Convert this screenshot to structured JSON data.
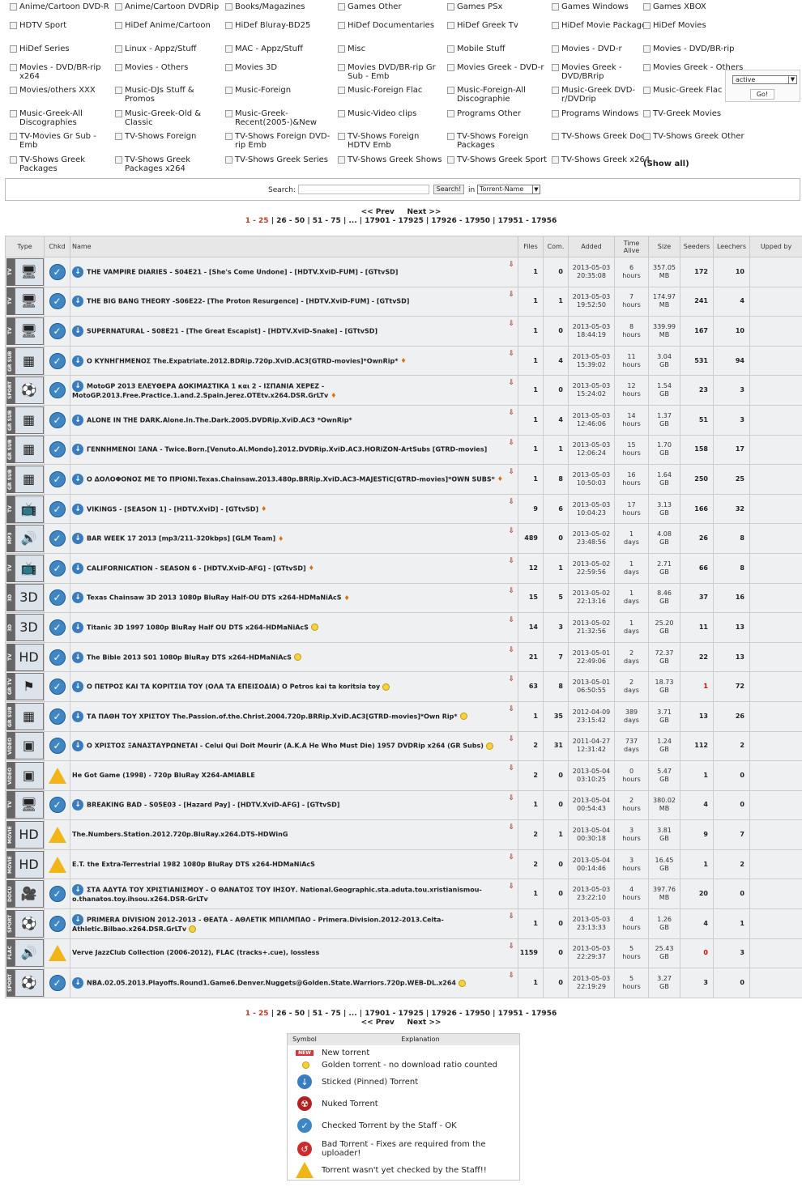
{
  "categories": [
    {
      "label": "Anime/Cartoon DVD-R",
      "col": 0,
      "row": 0
    },
    {
      "label": "Anime/Cartoon DVDRip",
      "col": 1,
      "row": 0
    },
    {
      "label": "Books/Magazines",
      "col": 2,
      "row": 0
    },
    {
      "label": "Games Other",
      "col": 3,
      "row": 0
    },
    {
      "label": "Games PSx",
      "col": 4,
      "row": 0
    },
    {
      "label": "Games Windows",
      "col": 5,
      "row": 0
    },
    {
      "label": "Games XBOX",
      "col": 6,
      "row": 0
    },
    {
      "label": "HDTV Sport",
      "col": 0,
      "row": 1
    },
    {
      "label": "HiDef Anime/Cartoon",
      "col": 1,
      "row": 1
    },
    {
      "label": "HiDef Bluray-BD25",
      "col": 2,
      "row": 1
    },
    {
      "label": "HiDef Documentaries",
      "col": 3,
      "row": 1
    },
    {
      "label": "HiDef Greek Tv",
      "col": 4,
      "row": 1
    },
    {
      "label": "HiDef Movie Packages",
      "col": 5,
      "row": 1
    },
    {
      "label": "HiDef Movies",
      "col": 6,
      "row": 1
    },
    {
      "label": "HiDef Series",
      "col": 0,
      "row": 2
    },
    {
      "label": "Linux - Appz/Stuff",
      "col": 1,
      "row": 2
    },
    {
      "label": "MAC - Appz/Stuff",
      "col": 2,
      "row": 2
    },
    {
      "label": "Misc",
      "col": 3,
      "row": 2
    },
    {
      "label": "Mobile Stuff",
      "col": 4,
      "row": 2
    },
    {
      "label": "Movies - DVD-r",
      "col": 5,
      "row": 2
    },
    {
      "label": "Movies - DVD/BR-rip",
      "col": 6,
      "row": 2
    },
    {
      "label": "Movies - DVD/BR-rip x264",
      "col": 0,
      "row": 3
    },
    {
      "label": "Movies - Others",
      "col": 1,
      "row": 3
    },
    {
      "label": "Movies 3D",
      "col": 2,
      "row": 3
    },
    {
      "label": "Movies DVD/BR-rip Gr Sub - Emb",
      "col": 3,
      "row": 3
    },
    {
      "label": "Movies Greek - DVD-r",
      "col": 4,
      "row": 3
    },
    {
      "label": "Movies Greek - DVD/BRrip",
      "col": 5,
      "row": 3
    },
    {
      "label": "Movies Greek - Others",
      "col": 6,
      "row": 3
    },
    {
      "label": "Movies/others XXX",
      "col": 0,
      "row": 4
    },
    {
      "label": "Music-DJs Stuff & Promos",
      "col": 1,
      "row": 4
    },
    {
      "label": "Music-Foreign",
      "col": 2,
      "row": 4
    },
    {
      "label": "Music-Foreign Flac",
      "col": 3,
      "row": 4
    },
    {
      "label": "Music-Foreign-All Discographie",
      "col": 4,
      "row": 4
    },
    {
      "label": "Music-Greek DVD-r/DVDrip",
      "col": 5,
      "row": 4
    },
    {
      "label": "Music-Greek Flac",
      "col": 6,
      "row": 4
    },
    {
      "label": "Music-Greek-All Discographies",
      "col": 0,
      "row": 5
    },
    {
      "label": "Music-Greek-Old & Classic",
      "col": 1,
      "row": 5
    },
    {
      "label": "Music-Greek-Recent(2005-)&New",
      "col": 2,
      "row": 5
    },
    {
      "label": "Music-Video clips",
      "col": 3,
      "row": 5
    },
    {
      "label": "Programs Other",
      "col": 4,
      "row": 5
    },
    {
      "label": "Programs Windows",
      "col": 5,
      "row": 5
    },
    {
      "label": "TV-Greek Movies",
      "col": 6,
      "row": 5
    },
    {
      "label": "TV-Movies Gr Sub - Emb",
      "col": 0,
      "row": 6
    },
    {
      "label": "TV-Shows Foreign",
      "col": 1,
      "row": 6
    },
    {
      "label": "TV-Shows Foreign DVD-rip Emb",
      "col": 2,
      "row": 6
    },
    {
      "label": "TV-Shows Foreign HDTV Emb",
      "col": 3,
      "row": 6
    },
    {
      "label": "TV-Shows Foreign Packages",
      "col": 4,
      "row": 6
    },
    {
      "label": "TV-Shows Greek Doc",
      "col": 5,
      "row": 6
    },
    {
      "label": "TV-Shows Greek Other",
      "col": 6,
      "row": 6
    },
    {
      "label": "TV-Shows Greek Packages",
      "col": 0,
      "row": 7
    },
    {
      "label": "TV-Shows Greek Packages x264",
      "col": 1,
      "row": 7
    },
    {
      "label": "TV-Shows Greek Series",
      "col": 2,
      "row": 7
    },
    {
      "label": "TV-Shows Greek Shows",
      "col": 3,
      "row": 7
    },
    {
      "label": "TV-Shows Greek Sport",
      "col": 4,
      "row": 7
    },
    {
      "label": "TV-Shows Greek x264",
      "col": 5,
      "row": 7
    }
  ],
  "show_all": "(Show all)",
  "filter": {
    "value": "active",
    "go": "Go!"
  },
  "search": {
    "label": "Search:",
    "button": "Search!",
    "in": "in",
    "field": "Torrent-Name"
  },
  "pager": {
    "prev": "<< Prev",
    "next": "Next >>",
    "current": "1 - 25",
    "pages": [
      "26 - 50",
      "51 - 75",
      "...",
      "17901 - 17925",
      "17926 - 17950",
      "17951 - 17956"
    ]
  },
  "table": {
    "headers": {
      "type": "Type",
      "checked": "Chkd",
      "name": "Name",
      "files": "Files",
      "comments": "Com.",
      "added": "Added",
      "alive": "Time Alive",
      "size": "Size",
      "seeders": "Seeders",
      "leechers": "Leechers",
      "uploader": "Upped by"
    },
    "rows": [
      {
        "type": "TV",
        "icon": "tv",
        "badge": "embedded",
        "check": "ok",
        "name": "THE VAMPIRE DIARIES - S04E21 - [She's Come Undone] - [HDTV.XviD-FUM] - [GTtvSD]",
        "marker": "",
        "files": "1",
        "comments": "0",
        "date": "2013-05-03",
        "time": "20:35:08",
        "alive_n": "6",
        "alive_u": "hours",
        "size_n": "357.05",
        "size_u": "MB",
        "seeders": "172",
        "leechers": "10",
        "seed_red": false
      },
      {
        "type": "TV",
        "icon": "tv",
        "badge": "embedded",
        "check": "ok",
        "name": "THE BIG BANG THEORY -S06E22- [The Proton Resurgence] - [HDTV.XviD-FUM] - [GTtvSD]",
        "marker": "",
        "files": "1",
        "comments": "1",
        "date": "2013-05-03",
        "time": "19:52:50",
        "alive_n": "7",
        "alive_u": "hours",
        "size_n": "174.97",
        "size_u": "MB",
        "seeders": "241",
        "leechers": "4",
        "seed_red": false
      },
      {
        "type": "TV",
        "icon": "tv",
        "badge": "embedded",
        "check": "ok",
        "name": "SUPERNATURAL - S08E21 - [The Great Escapist] - [HDTV.XviD-Snake] - [GTtvSD]",
        "marker": "",
        "files": "1",
        "comments": "0",
        "date": "2013-05-03",
        "time": "18:44:19",
        "alive_n": "8",
        "alive_u": "hours",
        "size_n": "339.99",
        "size_u": "MB",
        "seeders": "167",
        "leechers": "10",
        "seed_red": false
      },
      {
        "type": "GR SUB",
        "icon": "xvid",
        "badge": "embedded",
        "check": "ok",
        "name": "Ο ΚΥΝΗΓΗΜΕΝΟΣ The.Expatriate.2012.BDRip.720p.XviD.AC3[GTRD-movies]*OwnRip*",
        "marker": "flame",
        "files": "1",
        "comments": "4",
        "date": "2013-05-03",
        "time": "15:39:02",
        "alive_n": "11",
        "alive_u": "hours",
        "size_n": "3.04",
        "size_u": "GB",
        "seeders": "531",
        "leechers": "94",
        "seed_red": false
      },
      {
        "type": "SPORT",
        "icon": "ball",
        "badge": "",
        "check": "ok",
        "name": "MotoGP 2013 ΕΛΕΥΘΕΡΑ ΔΟΚΙΜΑΣΤΙΚΑ 1 και 2 - ΙΣΠΑΝΙΑ ΧΕΡΕΖ - MotoGP.2013.Free.Practice.1.and.2.Spain.Jerez.OTEtv.x264.DSR.GrLTv",
        "marker": "flame",
        "files": "1",
        "comments": "0",
        "date": "2013-05-03",
        "time": "15:24:02",
        "alive_n": "12",
        "alive_u": "hours",
        "size_n": "1.54",
        "size_u": "GB",
        "seeders": "23",
        "leechers": "3",
        "seed_red": false
      },
      {
        "type": "GR SUB",
        "icon": "xvid",
        "badge": "embedded",
        "check": "ok",
        "name": "ALONE IN THE DARK.Alone.In.The.Dark.2005.DVDRip.XviD.AC3 *OwnRip*",
        "marker": "",
        "files": "1",
        "comments": "4",
        "date": "2013-05-03",
        "time": "12:46:06",
        "alive_n": "14",
        "alive_u": "hours",
        "size_n": "1.37",
        "size_u": "GB",
        "seeders": "51",
        "leechers": "3",
        "seed_red": false
      },
      {
        "type": "GR SUB",
        "icon": "xvid",
        "badge": "embedded",
        "check": "ok",
        "name": "ΓΕΝΝΗΜΕΝΟΙ ΞΑΝΑ - Twice.Born.[Venuto.Al.Mondo].2012.DVDRip.XviD.AC3.HORiZON-ArtSubs [GTRD-movies]",
        "marker": "",
        "files": "1",
        "comments": "1",
        "date": "2013-05-03",
        "time": "12:06:24",
        "alive_n": "15",
        "alive_u": "hours",
        "size_n": "1.70",
        "size_u": "GB",
        "seeders": "158",
        "leechers": "17",
        "seed_red": false
      },
      {
        "type": "GR SUB",
        "icon": "xvid",
        "badge": "embedded",
        "check": "ok",
        "name": "Ο ΔΟΛΟΦΟΝΟΣ ΜΕ ΤΟ ΠΡΙΟΝΙ.Texas.Chainsaw.2013.480p.BRRip.XviD.AC3-MAJESTiC[GTRD-movies]*OWN SUBS*",
        "marker": "flame",
        "files": "1",
        "comments": "8",
        "date": "2013-05-03",
        "time": "10:50:03",
        "alive_n": "16",
        "alive_u": "hours",
        "size_n": "1.64",
        "size_u": "GB",
        "seeders": "250",
        "leechers": "25",
        "seed_red": false
      },
      {
        "type": "TV",
        "icon": "tvpack",
        "badge": "",
        "check": "ok",
        "name": "VIKINGS - [SEASON 1] - [HDTV.XviD] - [GTtvSD]",
        "marker": "flame",
        "files": "9",
        "comments": "6",
        "date": "2013-05-03",
        "time": "10:04:23",
        "alive_n": "17",
        "alive_u": "hours",
        "size_n": "3.13",
        "size_u": "GB",
        "seeders": "166",
        "leechers": "32",
        "seed_red": false
      },
      {
        "type": "MP3",
        "icon": "speaker",
        "badge": "",
        "check": "ok",
        "name": "BAR WEEK 17 2013 [mp3/211-320kbps] [GLM Team]",
        "marker": "flame",
        "files": "489",
        "comments": "0",
        "date": "2013-05-02",
        "time": "23:48:56",
        "alive_n": "1",
        "alive_u": "days",
        "size_n": "4.08",
        "size_u": "GB",
        "seeders": "26",
        "leechers": "8",
        "seed_red": false
      },
      {
        "type": "TV",
        "icon": "tvpack",
        "badge": "",
        "check": "ok",
        "name": "CALIFORNICATION - SEASON 6 - [HDTV.XviD-AFG] - [GTtvSD]",
        "marker": "flame",
        "files": "12",
        "comments": "1",
        "date": "2013-05-02",
        "time": "22:59:56",
        "alive_n": "1",
        "alive_u": "days",
        "size_n": "2.71",
        "size_u": "GB",
        "seeders": "66",
        "leechers": "8",
        "seed_red": false
      },
      {
        "type": "3D",
        "icon": "3d",
        "badge": "",
        "check": "ok",
        "name": "Texas Chainsaw 3D 2013 1080p BluRay Half-OU DTS x264-HDMaNiAcS",
        "marker": "flame",
        "files": "15",
        "comments": "5",
        "date": "2013-05-02",
        "time": "22:13:16",
        "alive_n": "1",
        "alive_u": "days",
        "size_n": "8.46",
        "size_u": "GB",
        "seeders": "37",
        "leechers": "16",
        "seed_red": false
      },
      {
        "type": "3D",
        "icon": "3d",
        "badge": "",
        "check": "ok",
        "name": "Titanic 3D 1997 1080p BluRay Half OU DTS x264-HDMaNiAcS",
        "marker": "gold",
        "files": "14",
        "comments": "3",
        "date": "2013-05-02",
        "time": "21:32:56",
        "alive_n": "1",
        "alive_u": "days",
        "size_n": "25.20",
        "size_u": "GB",
        "seeders": "11",
        "leechers": "13",
        "seed_red": false
      },
      {
        "type": "TV",
        "icon": "hd",
        "badge": "",
        "check": "ok",
        "name": "The Bible 2013 S01 1080p BluRay DTS x264-HDMaNiAcS",
        "marker": "gold",
        "files": "21",
        "comments": "7",
        "date": "2013-05-01",
        "time": "22:49:06",
        "alive_n": "2",
        "alive_u": "days",
        "size_n": "72.37",
        "size_u": "GB",
        "seeders": "22",
        "leechers": "13",
        "seed_red": false
      },
      {
        "type": "GR TV",
        "icon": "greek",
        "badge": "",
        "check": "ok",
        "name": "Ο ΠΕΤΡΟΣ ΚΑΙ ΤΑ ΚΟΡΙΤΣΙΑ ΤΟΥ (ΟΛΑ ΤΑ ΕΠΕΙΣΟΔΙΑ) O Petros kai ta koritsia toy",
        "marker": "gold",
        "files": "63",
        "comments": "8",
        "date": "2013-05-01",
        "time": "06:50:55",
        "alive_n": "2",
        "alive_u": "days",
        "size_n": "18.73",
        "size_u": "GB",
        "seeders": "1",
        "leechers": "72",
        "seed_red": true
      },
      {
        "type": "GR SUB",
        "icon": "xvid",
        "badge": "embedded",
        "check": "ok",
        "name": "ΤΑ ΠΑΘΗ ΤΟΥ ΧΡΙΣΤΟΥ The.Passion.of.the.Christ.2004.720p.BRRip.XviD.AC3[GTRD-movies]*Own Rip*",
        "marker": "gold",
        "files": "1",
        "comments": "35",
        "date": "2012-04-09",
        "time": "23:15:42",
        "alive_n": "389",
        "alive_u": "days",
        "size_n": "3.71",
        "size_u": "GB",
        "seeders": "13",
        "leechers": "26",
        "seed_red": false
      },
      {
        "type": "VIDEO",
        "icon": "x264",
        "badge": "",
        "check": "ok",
        "name": "Ο ΧΡΙΣΤΟΣ ΞΑΝΑΣΤΑΥΡΩΝΕΤΑΙ - Celui Qui Doit Mourir (A.K.A He Who Must Die) 1957 DVDRip x264 (GR Subs)",
        "marker": "gold",
        "files": "2",
        "comments": "31",
        "date": "2011-04-27",
        "time": "12:31:42",
        "alive_n": "737",
        "alive_u": "days",
        "size_n": "1.24",
        "size_u": "GB",
        "seeders": "112",
        "leechers": "2",
        "seed_red": false
      },
      {
        "type": "VIDEO",
        "icon": "x264",
        "badge": "",
        "check": "warn",
        "name": "He Got Game (1998) - 720p BluRay X264-AMIABLE",
        "marker": "",
        "files": "2",
        "comments": "0",
        "date": "2013-05-04",
        "time": "03:10:25",
        "alive_n": "0",
        "alive_u": "hours",
        "size_n": "5.47",
        "size_u": "GB",
        "seeders": "1",
        "leechers": "0",
        "seed_red": false
      },
      {
        "type": "TV",
        "icon": "tv",
        "badge": "embedded",
        "check": "ok",
        "name": "BREAKING BAD - S05E03 - [Hazard Pay] - [HDTV.XviD-AFG] - [GTtvSD]",
        "marker": "",
        "files": "1",
        "comments": "0",
        "date": "2013-05-04",
        "time": "00:54:43",
        "alive_n": "2",
        "alive_u": "hours",
        "size_n": "380.02",
        "size_u": "MB",
        "seeders": "4",
        "leechers": "0",
        "seed_red": false
      },
      {
        "type": "MOVIE",
        "icon": "hd",
        "badge": "",
        "check": "warn",
        "name": "The.Numbers.Station.2012.720p.BluRay.x264.DTS-HDWinG",
        "marker": "",
        "files": "2",
        "comments": "1",
        "date": "2013-05-04",
        "time": "00:30:18",
        "alive_n": "3",
        "alive_u": "hours",
        "size_n": "3.81",
        "size_u": "GB",
        "seeders": "9",
        "leechers": "7",
        "seed_red": false
      },
      {
        "type": "MOVIE",
        "icon": "hd",
        "badge": "",
        "check": "warn",
        "name": "E.T. the Extra-Terrestrial 1982 1080p BluRay DTS x264-HDMaNiAcS",
        "marker": "",
        "files": "2",
        "comments": "0",
        "date": "2013-05-04",
        "time": "00:14:46",
        "alive_n": "3",
        "alive_u": "hours",
        "size_n": "16.45",
        "size_u": "GB",
        "seeders": "1",
        "leechers": "2",
        "seed_red": false
      },
      {
        "type": "DOCU",
        "icon": "camera",
        "badge": "",
        "check": "ok",
        "name": "ΣΤΑ ΑΔΥΤΑ ΤΟΥ ΧΡΙΣΤΙΑΝΙΣΜΟΥ - Ο ΘΑΝΑΤΟΣ ΤΟΥ ΙΗΣΟΥ. National.Geographic.sta.aduta.tou.xristianismou-o.thanatos.toy.ihsou.x264.DSR-GrLTv",
        "marker": "",
        "files": "1",
        "comments": "0",
        "date": "2013-05-03",
        "time": "23:22:10",
        "alive_n": "4",
        "alive_u": "hours",
        "size_n": "397.76",
        "size_u": "MB",
        "seeders": "20",
        "leechers": "0",
        "seed_red": false
      },
      {
        "type": "SPORT",
        "icon": "ball",
        "badge": "",
        "check": "ok",
        "name": "PRIMERA DIVISION 2012-2013 - ΘΕΑΤΑ - ΑΘΛΕΤΙΚ ΜΠΙΛΜΠΑΟ - Primera.Division.2012-2013.Celta-Athletic.Bilbao.x264.DSR.GrLTv",
        "marker": "gold",
        "files": "1",
        "comments": "0",
        "date": "2013-05-03",
        "time": "23:13:33",
        "alive_n": "4",
        "alive_u": "hours",
        "size_n": "1.26",
        "size_u": "GB",
        "seeders": "4",
        "leechers": "1",
        "seed_red": false
      },
      {
        "type": "FLAC",
        "icon": "speaker",
        "badge": "",
        "check": "warn",
        "name": "Verve JazzClub Collection (2006-2012), FLAC (tracks+.cue), lossless",
        "marker": "",
        "files": "1159",
        "comments": "0",
        "date": "2013-05-03",
        "time": "22:29:37",
        "alive_n": "5",
        "alive_u": "hours",
        "size_n": "25.43",
        "size_u": "GB",
        "seeders": "0",
        "leechers": "3",
        "seed_red": true
      },
      {
        "type": "SPORT",
        "icon": "ball",
        "badge": "",
        "check": "ok",
        "name": "NBA.02.05.2013.Playoffs.Round1.Game6.Denver.Nuggets@Golden.State.Warriors.720p.WEB-DL.x264",
        "marker": "gold",
        "files": "1",
        "comments": "0",
        "date": "2013-05-03",
        "time": "22:19:29",
        "alive_n": "5",
        "alive_u": "hours",
        "size_n": "3.27",
        "size_u": "GB",
        "seeders": "3",
        "leechers": "0",
        "seed_red": false
      }
    ]
  },
  "legend": {
    "header_symbol": "Symbol",
    "header_explanation": "Explanation",
    "new_badge": "NEW",
    "items": [
      {
        "icon": "new-icon",
        "text": "New torrent"
      },
      {
        "icon": "gold-coin-icon",
        "text": "Golden torrent - no download ratio counted"
      },
      {
        "icon": "pin-icon",
        "text": "Sticked (Pinned) Torrent"
      },
      {
        "icon": "nuke-icon",
        "text": "Nuked Torrent"
      },
      {
        "icon": "check-icon",
        "text": "Checked Torrent by the Staff - OK"
      },
      {
        "icon": "bad-icon",
        "text": "Bad Torrent - Fixes are required from the uploader!"
      },
      {
        "icon": "warning-icon",
        "text": "Torrent wasn't yet checked by the Staff!!"
      }
    ]
  },
  "colors": {
    "accent": "#3f86c4",
    "warning": "#f2b417",
    "current_page": "#c0392b",
    "row_bg": "#eef0f2"
  }
}
